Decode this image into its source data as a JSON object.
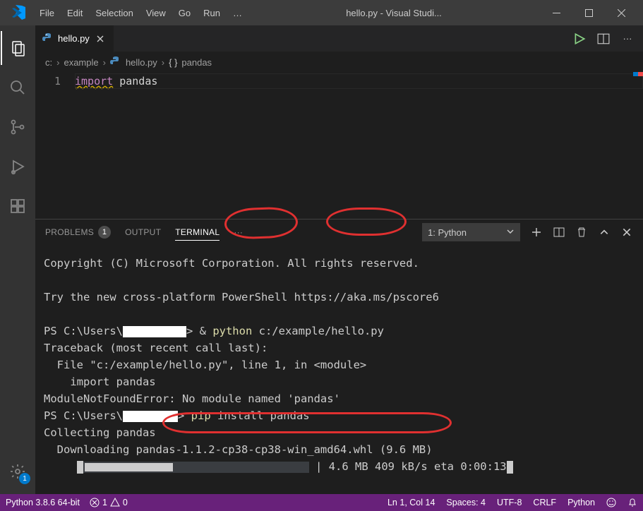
{
  "window": {
    "title": "hello.py - Visual Studi..."
  },
  "menu": [
    "File",
    "Edit",
    "Selection",
    "View",
    "Go",
    "Run",
    "…"
  ],
  "tab": {
    "filename": "hello.py"
  },
  "tab_actions": {
    "run_tooltip": "Run",
    "split_tooltip": "Split",
    "more_tooltip": "More"
  },
  "breadcrumb": [
    "c:",
    "example",
    "hello.py",
    "pandas"
  ],
  "code": {
    "line1_kw": "import",
    "line1_rest": " pandas",
    "line_num": "1"
  },
  "panel": {
    "tabs": {
      "problems": "PROBLEMS",
      "problems_count": "1",
      "output": "OUTPUT",
      "terminal": "TERMINAL",
      "more": "···"
    },
    "terminal_select": "1: Python"
  },
  "terminal": {
    "l1": "Copyright (C) Microsoft Corporation. All rights reserved.",
    "l2": "Try the new cross-platform PowerShell https://aka.ms/pscore6",
    "l3a": "PS C:\\Users\\",
    "l3b": "> & ",
    "l3c": "python",
    "l3d": " c:/example/hello.py",
    "l4": "Traceback (most recent call last):",
    "l5": "  File \"c:/example/hello.py\", line 1, in <module>",
    "l6": "    import pandas",
    "l7": "ModuleNotFoundError: No module named 'pandas'",
    "l8a": "PS C:\\Users\\",
    "l8b": "> ",
    "l8c": "pip",
    "l8d": " install pandas",
    "l9": "Collecting pandas",
    "l10": "  Downloading pandas-1.1.2-cp38-cp38-win_amd64.whl (9.6 MB)",
    "l11b": "| 4.6 MB 409 kB/s eta 0:00:13"
  },
  "status": {
    "python": "Python 3.8.6 64-bit",
    "errors": "1",
    "warnings": "0",
    "ln": "Ln 1, Col 14",
    "spaces": "Spaces: 4",
    "encoding": "UTF-8",
    "eol": "CRLF",
    "lang": "Python"
  },
  "activity": {
    "settings_badge": "1"
  }
}
